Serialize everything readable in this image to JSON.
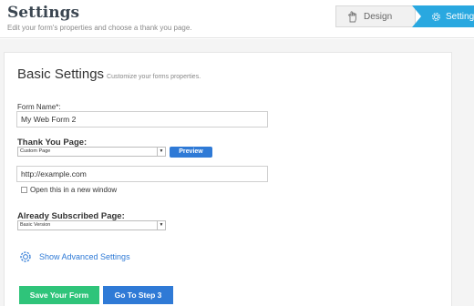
{
  "header": {
    "title": "Settings",
    "subtitle": "Edit your form's properties and choose a thank you page."
  },
  "steps": {
    "design_label": "Design",
    "settings_label": "Settings",
    "active_color": "#29a8e0"
  },
  "basic": {
    "title": "Basic Settings",
    "subtitle": "Customize your forms properties."
  },
  "form_name": {
    "label": "Form Name*:",
    "value": "My Web Form 2"
  },
  "thank_you": {
    "label": "Thank You Page:",
    "selected": "Custom Page",
    "preview_label": "Preview",
    "url_value": "http://example.com",
    "new_window_label": "Open this in a new window"
  },
  "subscribed": {
    "label": "Already Subscribed Page:",
    "selected": "Basic Version"
  },
  "advanced": {
    "label": "Show Advanced Settings"
  },
  "actions": {
    "save_label": "Save Your Form",
    "next_label": "Go To Step 3",
    "save_color": "#2fc47a",
    "next_color": "#2f7ad6"
  },
  "icons": [
    "hand-pointer-icon",
    "gear-icon",
    "gear-outline-icon",
    "chevron-down-icon"
  ]
}
